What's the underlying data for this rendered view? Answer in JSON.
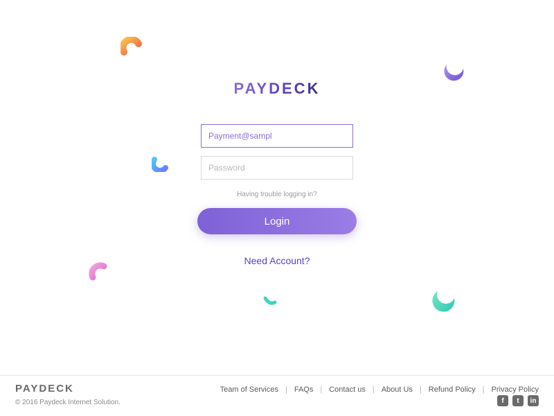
{
  "brand": "PAYDECK",
  "form": {
    "email_value": "Payment@sampl",
    "password_placeholder": "Password",
    "trouble_text": "Having trouble logging in?",
    "login_label": "Login",
    "need_account_label": "Need Account?"
  },
  "footer": {
    "logo": "PAYDECK",
    "copyright": "© 2016 Paydeck Internet Solution.",
    "links": [
      "Team of Services",
      "FAQs",
      "Contact us",
      "About Us",
      "Refund Policy",
      "Privacy Policy"
    ],
    "social": {
      "facebook": "f",
      "twitter": "t",
      "linkedin": "in"
    }
  }
}
